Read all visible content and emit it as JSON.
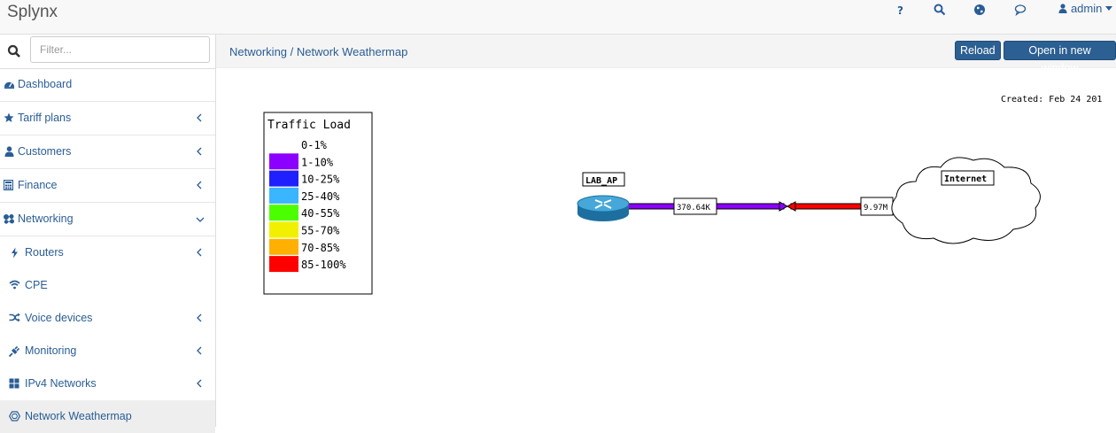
{
  "app": {
    "brand": "Splynx"
  },
  "topbar": {
    "user_label": "admin"
  },
  "search": {
    "placeholder": "Filter..."
  },
  "sidebar": {
    "items": [
      {
        "label": "Dashboard"
      },
      {
        "label": "Tariff plans"
      },
      {
        "label": "Customers"
      },
      {
        "label": "Finance"
      },
      {
        "label": "Networking"
      },
      {
        "label": "Routers"
      },
      {
        "label": "CPE"
      },
      {
        "label": "Voice devices"
      },
      {
        "label": "Monitoring"
      },
      {
        "label": "IPv4 Networks"
      },
      {
        "label": "Network Weathermap"
      }
    ]
  },
  "header": {
    "breadcrumb": "Networking / Network Weathermap",
    "reload_label": "Reload",
    "open_label": "Open in new window"
  },
  "weathermap": {
    "created": "Created: Feb 24 201",
    "legend": {
      "title": "Traffic Load",
      "entries": [
        {
          "label": "0-1%",
          "color": "#ffffff"
        },
        {
          "label": "1-10%",
          "color": "#8c00ff"
        },
        {
          "label": "10-25%",
          "color": "#2020ff"
        },
        {
          "label": "25-40%",
          "color": "#3ab5ff"
        },
        {
          "label": "40-55%",
          "color": "#4cff00"
        },
        {
          "label": "55-70%",
          "color": "#f0f000"
        },
        {
          "label": "70-85%",
          "color": "#ffb000"
        },
        {
          "label": "85-100%",
          "color": "#ff0000"
        }
      ]
    },
    "nodes": {
      "ap_label": "LAB_AP",
      "cloud_label": "Internet"
    },
    "link": {
      "out_label": "370.64K",
      "in_label": "9.97M",
      "out_color": "#8c00ff",
      "in_color": "#ff0000"
    }
  },
  "colors": {
    "link": "#2a5d95",
    "button": "#2c5f92"
  }
}
